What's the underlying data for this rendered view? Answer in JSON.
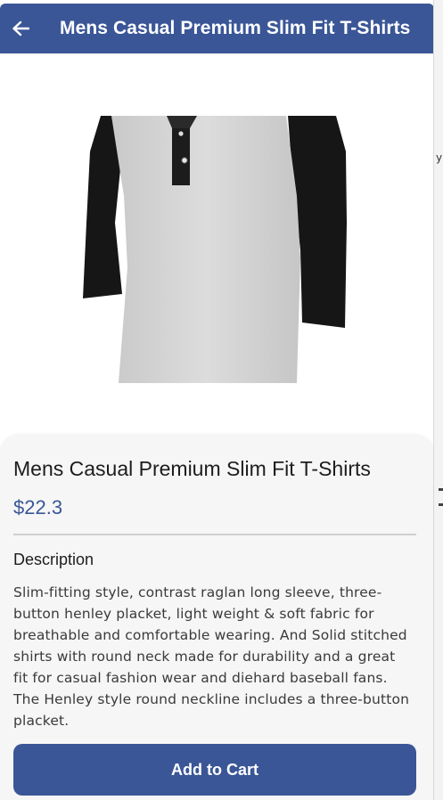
{
  "appbar": {
    "back_icon": "arrow-left-icon",
    "title": "Mens Casual Premium Slim Fit T-Shirts"
  },
  "product": {
    "image_alt": "Raglan henley t-shirt with light grey body and black sleeves",
    "title": "Mens Casual Premium Slim Fit T-Shirts",
    "price": "$22.3",
    "description_heading": "Description",
    "description": "Slim-fitting style, contrast raglan long sleeve, three-button henley placket, light weight & soft fabric for breathable and comfortable wearing. And Solid stitched shirts with round neck made for durability and a great fit for casual fashion wear and diehard baseball fans. The Henley style round neckline includes a three-button placket."
  },
  "actions": {
    "add_to_cart_label": "Add to Cart"
  },
  "colors": {
    "primary": "#3a5697",
    "sheet_background": "#f6f6f6",
    "text": "#1d1d1d"
  }
}
